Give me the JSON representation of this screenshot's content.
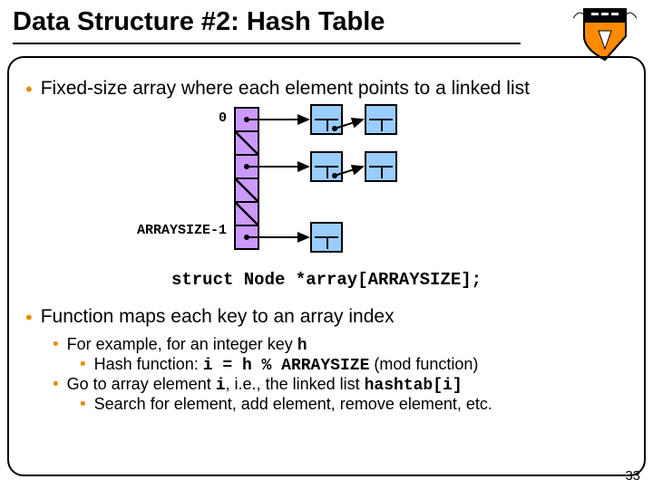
{
  "title": "Data Structure #2: Hash Table",
  "crest_alt": "princeton-shield",
  "bullets": {
    "b1": "Fixed-size array where each element points to a linked list",
    "b2": "Function maps each key to an array index",
    "s1_prefix": "For example, for an integer key ",
    "s1_code": "h",
    "s2_prefix": "Hash function: ",
    "s2_code": "i = h % ARRAYSIZE",
    "s2_suffix": " (mod function)",
    "s3_a": "Go to array element ",
    "s3_code1": "i",
    "s3_b": ", i.e., the linked list ",
    "s3_code2": "hashtab[i]",
    "s4": "Search for element, add element, remove element, etc."
  },
  "caption": "struct Node *array[ARRAYSIZE];",
  "labels": {
    "zero": "0",
    "last": "ARRAYSIZE-1"
  },
  "pagenum": "33"
}
